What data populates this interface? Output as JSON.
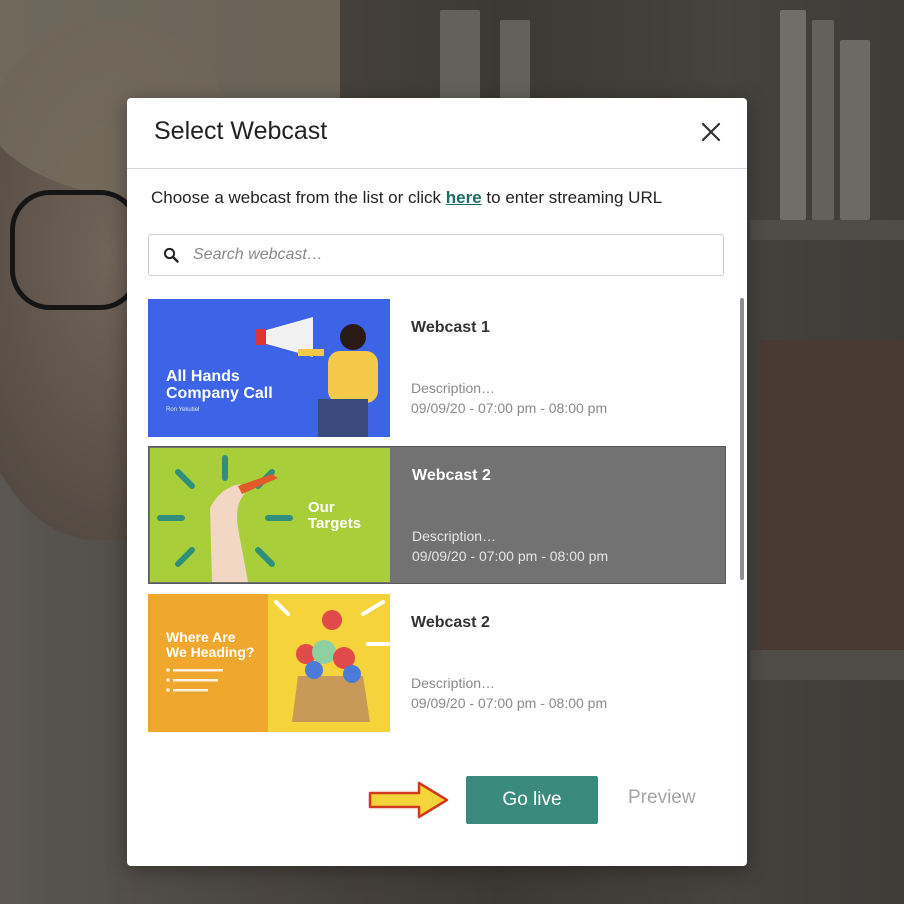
{
  "modal": {
    "title": "Select Webcast",
    "instruction_before": "Choose a webcast from the list or click ",
    "instruction_link": "here",
    "instruction_after": " to enter streaming URL",
    "search_placeholder": "Search webcast…"
  },
  "webcasts": [
    {
      "name": "Webcast 1",
      "description": "Description…",
      "time": "09/09/20 - 07:00 pm - 08:00 pm",
      "thumb_title": "All Hands\nCompany Call",
      "thumb_subtitle": "Ron Yekutiel",
      "thumb_color": "#3d63e6",
      "selected": false
    },
    {
      "name": "Webcast 2",
      "description": "Description…",
      "time": "09/09/20 - 07:00 pm - 08:00 pm",
      "thumb_title": "Our\nTargets",
      "thumb_color": "#a8cf3a",
      "selected": true
    },
    {
      "name": "Webcast 2",
      "description": "Description…",
      "time": "09/09/20 - 07:00 pm - 08:00 pm",
      "thumb_title": "Where Are\nWe Heading?",
      "thumb_color": "#f0a72e",
      "selected": false
    }
  ],
  "actions": {
    "go_live_label": "Go live",
    "preview_label": "Preview"
  },
  "colors": {
    "accent": "#3b8a7e",
    "link": "#1a6b64",
    "selected_row": "#727272",
    "arrow_fill": "#f5d33a",
    "arrow_stroke": "#d23a1f"
  }
}
